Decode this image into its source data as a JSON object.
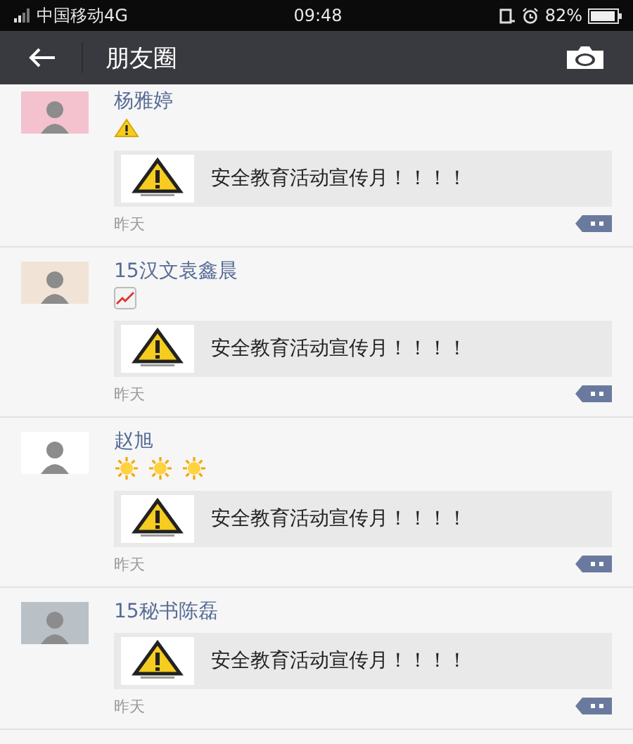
{
  "status_bar": {
    "carrier": "中国移动4G",
    "time": "09:48",
    "battery": "82%"
  },
  "nav": {
    "title": "朋友圈"
  },
  "posts": [
    {
      "name": "杨雅婷",
      "avatar": {
        "color": "#f4c2cf"
      },
      "emoji": [
        {
          "kind": "warning"
        }
      ],
      "link": {
        "text": "安全教育活动宣传月！！！！"
      },
      "time": "昨天"
    },
    {
      "name": "15汉文袁鑫晨",
      "avatar": {
        "color": "#f1e4d6"
      },
      "emoji": [
        {
          "kind": "chart"
        }
      ],
      "link": {
        "text": "安全教育活动宣传月！！！！"
      },
      "time": "昨天"
    },
    {
      "name": "赵旭",
      "avatar": {
        "color": "#ffffff"
      },
      "emoji": [
        {
          "kind": "sun"
        },
        {
          "kind": "sun"
        },
        {
          "kind": "sun"
        }
      ],
      "link": {
        "text": "安全教育活动宣传月！！！！"
      },
      "time": "昨天"
    },
    {
      "name": "15秘书陈磊",
      "avatar": {
        "color": "#b9c0c6"
      },
      "link": {
        "text": "安全教育活动宣传月！！！！"
      },
      "time": "昨天"
    }
  ]
}
